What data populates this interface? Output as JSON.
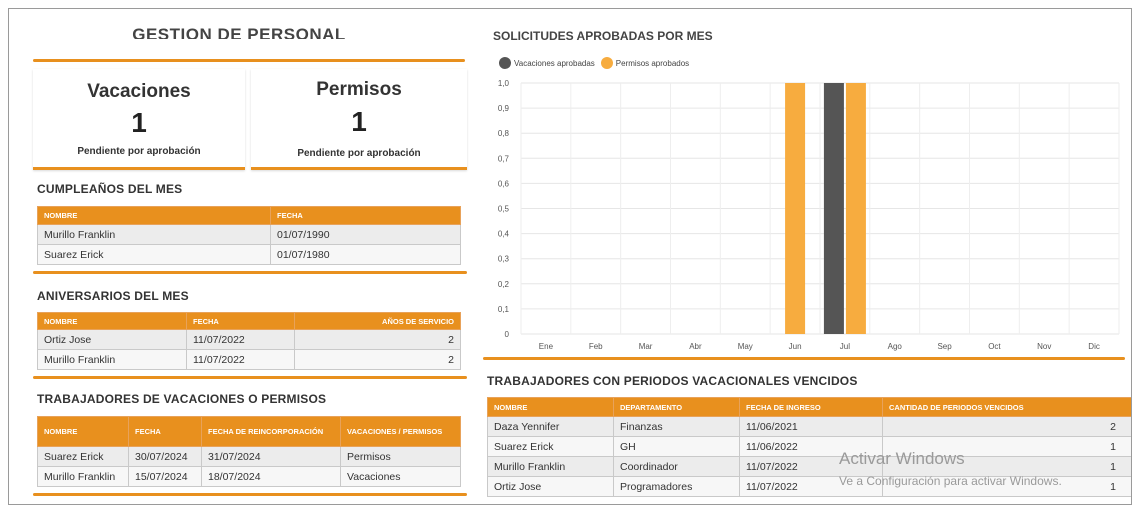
{
  "header": {
    "title": "GESTION DE PERSONAL"
  },
  "cards": [
    {
      "title": "Vacaciones",
      "count": "1",
      "subtitle": "Pendiente por aprobación"
    },
    {
      "title": "Permisos",
      "count": "1",
      "subtitle": "Pendiente por aprobación"
    }
  ],
  "birthdays": {
    "title": "CUMPLEAÑOS DEL MES",
    "columns": [
      "NOMBRE",
      "FECHA"
    ],
    "rows": [
      [
        "Murillo Franklin",
        "01/07/1990"
      ],
      [
        "Suarez Erick",
        "01/07/1980"
      ]
    ]
  },
  "anniversaries": {
    "title": "ANIVERSARIOS DEL MES",
    "columns": [
      "NOMBRE",
      "FECHA",
      "AÑOS DE SERVICIO"
    ],
    "rows": [
      [
        "Ortiz Jose",
        "11/07/2022",
        "2"
      ],
      [
        "Murillo Franklin",
        "11/07/2022",
        "2"
      ]
    ]
  },
  "on_leave": {
    "title": "TRABAJADORES DE VACACIONES O PERMISOS",
    "columns": [
      "NOMBRE",
      "FECHA",
      "FECHA DE REINCORPORACIÓN",
      "VACACIONES / PERMISOS"
    ],
    "rows": [
      [
        "Suarez Erick",
        "30/07/2024",
        "31/07/2024",
        "Permisos"
      ],
      [
        "Murillo Franklin",
        "15/07/2024",
        "18/07/2024",
        "Vacaciones"
      ]
    ]
  },
  "expired": {
    "title": "TRABAJADORES CON PERIODOS VACACIONALES VENCIDOS",
    "columns": [
      "NOMBRE",
      "DEPARTAMENTO",
      "FECHA DE INGRESO",
      "CANTIDAD DE PERIODOS VENCIDOS"
    ],
    "rows": [
      [
        "Daza Yennifer",
        "Finanzas",
        "11/06/2021",
        "2"
      ],
      [
        "Suarez Erick",
        "GH",
        "11/06/2022",
        "1"
      ],
      [
        "Murillo Franklin",
        "Coordinador",
        "11/07/2022",
        "1"
      ],
      [
        "Ortiz Jose",
        "Programadores",
        "11/07/2022",
        "1"
      ]
    ]
  },
  "watermark": {
    "line1": "Activar Windows",
    "line2": "Ve a Configuración para activar Windows."
  },
  "chart_data": {
    "type": "bar",
    "title": "SOLICITUDES APROBADAS POR MES",
    "categories": [
      "Ene",
      "Feb",
      "Mar",
      "Abr",
      "May",
      "Jun",
      "Jul",
      "Ago",
      "Sep",
      "Oct",
      "Nov",
      "Dic"
    ],
    "series": [
      {
        "name": "Vacaciones aprobadas",
        "color": "#555555",
        "values": [
          0,
          0,
          0,
          0,
          0,
          0,
          1,
          0,
          0,
          0,
          0,
          0
        ]
      },
      {
        "name": "Permisos aprobados",
        "color": "#f7ac3f",
        "values": [
          0,
          0,
          0,
          0,
          0,
          1,
          1,
          0,
          0,
          0,
          0,
          0
        ]
      }
    ],
    "ylim": [
      0,
      1
    ],
    "yticks": [
      "0",
      "0,1",
      "0,2",
      "0,3",
      "0,4",
      "0,5",
      "0,6",
      "0,7",
      "0,8",
      "0,9",
      "1,0"
    ],
    "grid": true,
    "legend": "top-left"
  }
}
